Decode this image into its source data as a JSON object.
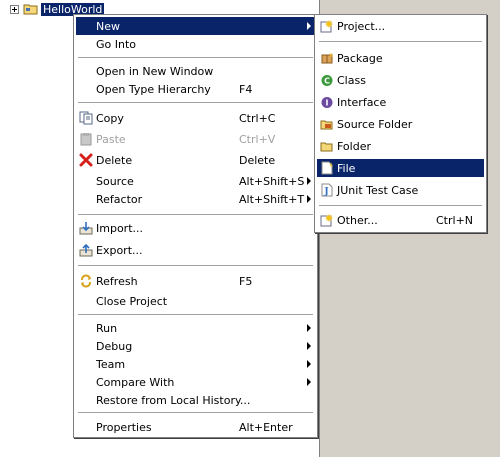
{
  "tree": {
    "project_label": "HelloWorld"
  },
  "context_menu": {
    "items": [
      {
        "label": "New",
        "submenu": true
      },
      {
        "label": "Go Into"
      },
      {
        "label": "Open in New Window"
      },
      {
        "label": "Open Type Hierarchy",
        "shortcut": "F4"
      },
      {
        "label": "Copy",
        "shortcut": "Ctrl+C",
        "icon": "copy-icon"
      },
      {
        "label": "Paste",
        "shortcut": "Ctrl+V",
        "icon": "paste-icon",
        "disabled": true
      },
      {
        "label": "Delete",
        "shortcut": "Delete",
        "icon": "delete-icon"
      },
      {
        "label": "Source",
        "shortcut": "Alt+Shift+S",
        "submenu": true
      },
      {
        "label": "Refactor",
        "shortcut": "Alt+Shift+T",
        "submenu": true
      },
      {
        "label": "Import...",
        "icon": "import-icon"
      },
      {
        "label": "Export...",
        "icon": "export-icon"
      },
      {
        "label": "Refresh",
        "shortcut": "F5",
        "icon": "refresh-icon"
      },
      {
        "label": "Close Project"
      },
      {
        "label": "Run",
        "submenu": true
      },
      {
        "label": "Debug",
        "submenu": true
      },
      {
        "label": "Team",
        "submenu": true
      },
      {
        "label": "Compare With",
        "submenu": true
      },
      {
        "label": "Restore from Local History..."
      },
      {
        "label": "Properties",
        "shortcut": "Alt+Enter"
      }
    ]
  },
  "new_submenu": {
    "items": [
      {
        "label": "Project...",
        "icon": "new-project-icon"
      },
      {
        "label": "Package",
        "icon": "package-icon"
      },
      {
        "label": "Class",
        "icon": "class-icon"
      },
      {
        "label": "Interface",
        "icon": "interface-icon"
      },
      {
        "label": "Source Folder",
        "icon": "source-folder-icon"
      },
      {
        "label": "Folder",
        "icon": "folder-icon"
      },
      {
        "label": "File",
        "icon": "file-icon",
        "highlighted": true
      },
      {
        "label": "JUnit Test Case",
        "icon": "junit-icon"
      },
      {
        "label": "Other...",
        "shortcut": "Ctrl+N",
        "icon": "other-wizard-icon"
      }
    ]
  },
  "colors": {
    "highlight": "#0a246a",
    "background": "#d4d0c8",
    "menu": "#ffffff",
    "disabled": "#a0a0a0"
  }
}
